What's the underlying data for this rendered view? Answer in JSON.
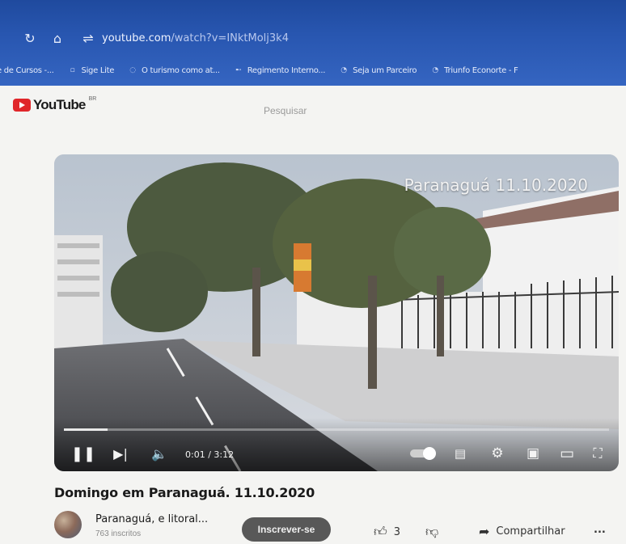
{
  "browser": {
    "url_domain": "youtube.com",
    "url_path": "/watch?v=INktMolj3k4",
    "icons": [
      "reload-icon",
      "home-icon",
      "site-settings-icon"
    ],
    "bookmarks": [
      {
        "label": "e de Cursos -...",
        "icon": "page-icon"
      },
      {
        "label": "Sige Lite",
        "icon": "page-icon"
      },
      {
        "label": "O turismo como at...",
        "icon": "page-icon"
      },
      {
        "label": "Regimento Interno...",
        "icon": "bookmark-icon"
      },
      {
        "label": "Seja um Parceiro",
        "icon": "page-icon"
      },
      {
        "label": "Triunfo Econorte - F",
        "icon": "page-icon"
      }
    ]
  },
  "youtube": {
    "logo_text": "YouTube",
    "region": "BR",
    "search_placeholder": "Pesquisar"
  },
  "player": {
    "overlay_title": "Paranaguá 11.10.2020",
    "time_display": "0:01 / 3:12",
    "progress": 0.08,
    "controls": [
      "pause-icon",
      "next-icon",
      "volume-icon",
      "autoplay-toggle",
      "subtitles-icon",
      "settings-icon",
      "miniplayer-icon",
      "theater-icon",
      "fullscreen-icon"
    ]
  },
  "video": {
    "title": "Domingo em Paranaguá. 11.10.2020",
    "channel_name": "Paranaguá, e litoral...",
    "subscribers": "763 inscritos",
    "subscribe_label": "Inscrever-se",
    "likes": "3",
    "share_label": "Compartilhar",
    "more_label": "..."
  },
  "colors": {
    "browser_bar": "#2856b0",
    "yt_red": "#e0262a",
    "subscribe_bg": "#585858"
  }
}
